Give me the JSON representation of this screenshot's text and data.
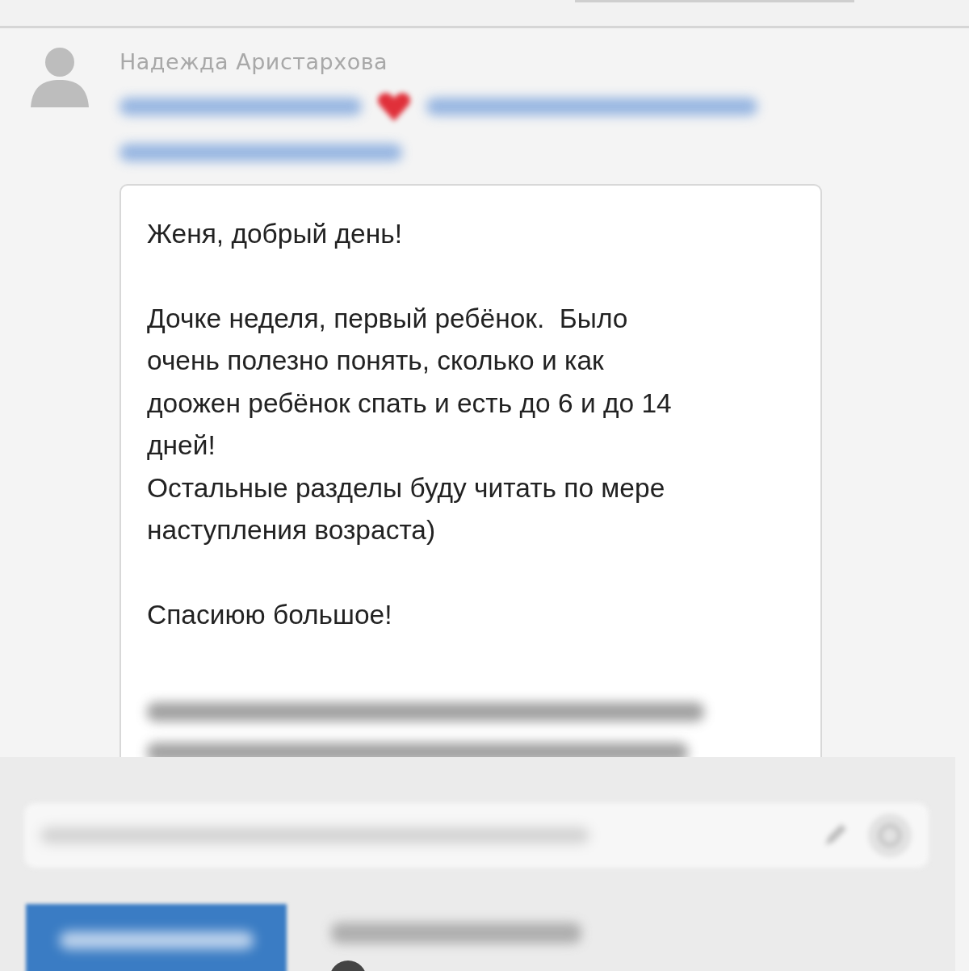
{
  "message": {
    "author": "Надежда Аристархова",
    "paragraphs": [
      {
        "lines": [
          "Женя, добрый день!"
        ]
      },
      {
        "lines": [
          "Дочке неделя, первый ребёнок.  Было",
          "очень полезно понять, сколько и как",
          "доожен ребёнок спать и есть до 6 и до 14",
          "дней!",
          "Остальные разделы буду читать по мере",
          "наступления возраста)"
        ]
      },
      {
        "lines": [
          "Спасиюю большое!"
        ]
      }
    ]
  }
}
